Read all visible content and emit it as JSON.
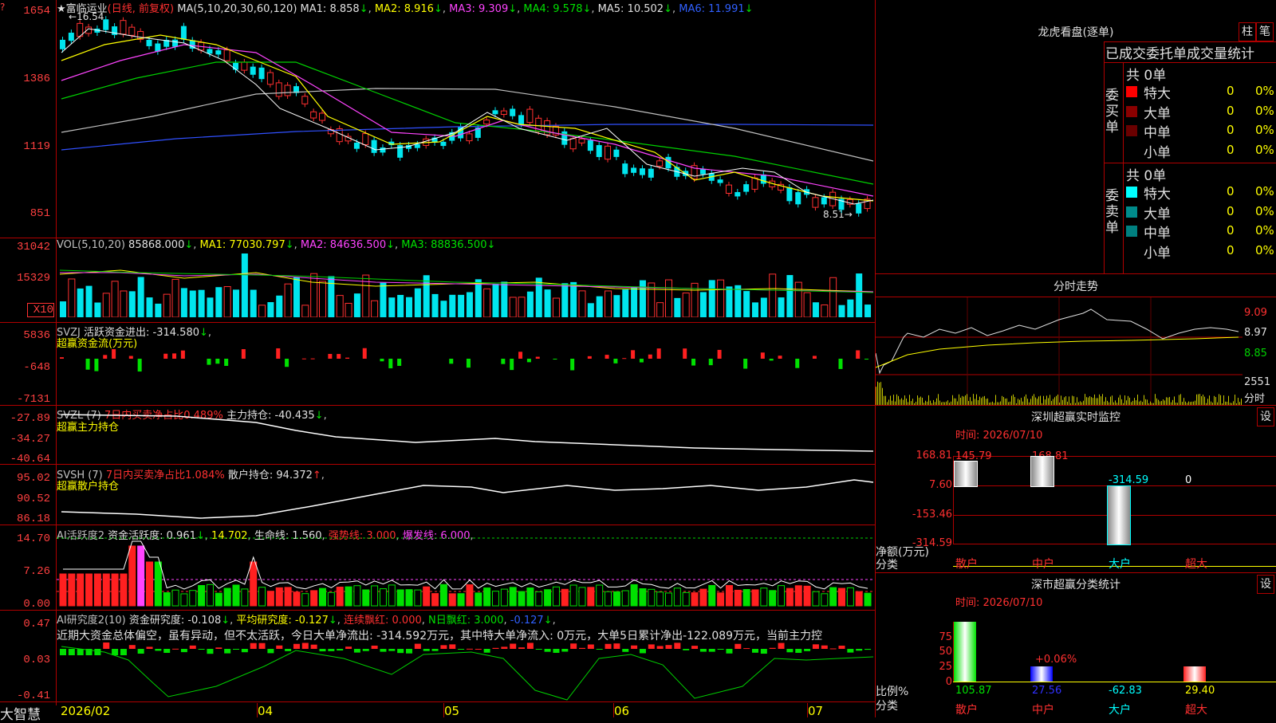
{
  "stock": {
    "name": "富临运业",
    "mode": "(日线, 前复权)",
    "high_mark": "16.54",
    "low_mark": "8.51"
  },
  "main_panel": {
    "axis": [
      "1654",
      "1386",
      "1119",
      "851"
    ],
    "ma": {
      "label": "MA(5,10,20,30,60,120)",
      "ma1": "MA1: 8.858",
      "ma2": "MA2: 8.916",
      "ma3": "MA3: 9.309",
      "ma4": "MA4: 9.578",
      "ma5": "MA5: 10.502",
      "ma6": "MA6: 11.991"
    },
    "colors": {
      "ma1": "#ffffff",
      "ma2": "#ffff00",
      "ma3": "#ff44ff",
      "ma4": "#00d000",
      "ma5": "#c0c0c0",
      "ma6": "#3050ff",
      "up": "#ff3030",
      "down": "#00e5ee"
    }
  },
  "vol_panel": {
    "axis": [
      "31042",
      "15329",
      "X10"
    ],
    "label": "VOL(5,10,20)",
    "value": "85868.000",
    "ma1": "MA1: 77030.797",
    "ma2": "MA2: 84636.500",
    "ma3": "MA3: 88836.500"
  },
  "svzj_panel": {
    "axis": [
      "5836",
      "-648",
      "-7131"
    ],
    "label": "SVZJ",
    "desc": "活跃资金进出: -314.580",
    "sub": "超赢资金流(万元)"
  },
  "svzl_panel": {
    "axis": [
      "-27.89",
      "-34.27",
      "-40.64"
    ],
    "label": "SVZL (7)",
    "desc": "7日内买卖净占比0.489%",
    "hold": "主力持仓: -40.435",
    "sub": "超赢主力持仓"
  },
  "svsh_panel": {
    "axis": [
      "95.02",
      "90.52",
      "86.18"
    ],
    "label": "SVSH (7)",
    "desc": "7日内买卖净占比1.084%",
    "hold": "散户持仓: 94.372",
    "sub": "超赢散户持仓"
  },
  "ai_active": {
    "axis": [
      "14.70",
      "7.26",
      "0.00"
    ],
    "label": "AI活跃度2",
    "a": "资金活跃度: 0.961",
    "b": "14.702",
    "c": "生命线: 1.560",
    "d": "强势线: 3.000",
    "e": "爆发线: 6.000"
  },
  "ai_research": {
    "axis": [
      "0.47",
      "0.03",
      "-0.41"
    ],
    "label": "AI研究度2(10)",
    "a": "资金研究度: -0.108",
    "b": "平均研究度: -0.127",
    "c": "连续飘红: 0.000",
    "d": "N日飘红: 3.000",
    "e": "-0.127",
    "comment": "近期大资金总体偏空，虽有异动，但不太活跃，今日大单净流出: -314.592万元，其中特大单净流入: 0万元，大单5日累计净出-122.089万元，当前主力控"
  },
  "dates": {
    "start": "2026/02",
    "m04": "04",
    "m05": "05",
    "m06": "06",
    "m07": "07"
  },
  "brand": "大智慧",
  "dragon": {
    "title": "龙虎看盘(逐单)",
    "tab1": "柱",
    "tab2": "笔",
    "header": "已成交委托单成交量统计",
    "buy": {
      "side": "委买单",
      "total": "共 0单",
      "rows": [
        {
          "name": "特大",
          "v": "0",
          "p": "0%",
          "c": "#ff0000"
        },
        {
          "name": "大单",
          "v": "0",
          "p": "0%",
          "c": "#8b0000"
        },
        {
          "name": "中单",
          "v": "0",
          "p": "0%",
          "c": "#6a0000"
        },
        {
          "name": "小单",
          "v": "0",
          "p": "0%",
          "c": "#000000"
        }
      ]
    },
    "sell": {
      "side": "委卖单",
      "total": "共 0单",
      "rows": [
        {
          "name": "特大",
          "v": "0",
          "p": "0%",
          "c": "#00ffff"
        },
        {
          "name": "大单",
          "v": "0",
          "p": "0%",
          "c": "#008b8b"
        },
        {
          "name": "中单",
          "v": "0",
          "p": "0%",
          "c": "#008080"
        },
        {
          "name": "小单",
          "v": "0",
          "p": "0%",
          "c": "#000000"
        }
      ]
    }
  },
  "intraday": {
    "title": "分时走势",
    "p1": "9.09",
    "p2": "8.97",
    "p3": "8.85",
    "vol": "2551",
    "vol_lbl": "分时"
  },
  "sz_monitor": {
    "title": "深圳超赢实时监控",
    "btn": "设",
    "time": "时间: 2026/07/10",
    "axis": [
      "168.81",
      "7.60",
      "-153.46",
      "-314.59"
    ],
    "ylabel": "净额(万元)",
    "xlabel": "分类",
    "bars": [
      {
        "name": "散户",
        "v": "145.79"
      },
      {
        "name": "中户",
        "v": "168.81"
      },
      {
        "name": "大户",
        "v": "-314.59"
      },
      {
        "name": "超大",
        "v": "0"
      }
    ]
  },
  "sz_class": {
    "title": "深市超赢分类统计",
    "btn": "设",
    "time": "时间: 2026/07/10",
    "axis": [
      "75",
      "50",
      "25",
      "0"
    ],
    "ylabel": "比例%",
    "xlabel": "分类",
    "pct": "+0.06%",
    "bars": [
      {
        "name": "散户",
        "v": "105.87"
      },
      {
        "name": "中户",
        "v": "27.56"
      },
      {
        "name": "大户",
        "v": "-62.83"
      },
      {
        "name": "超大",
        "v": "29.40"
      }
    ]
  }
}
